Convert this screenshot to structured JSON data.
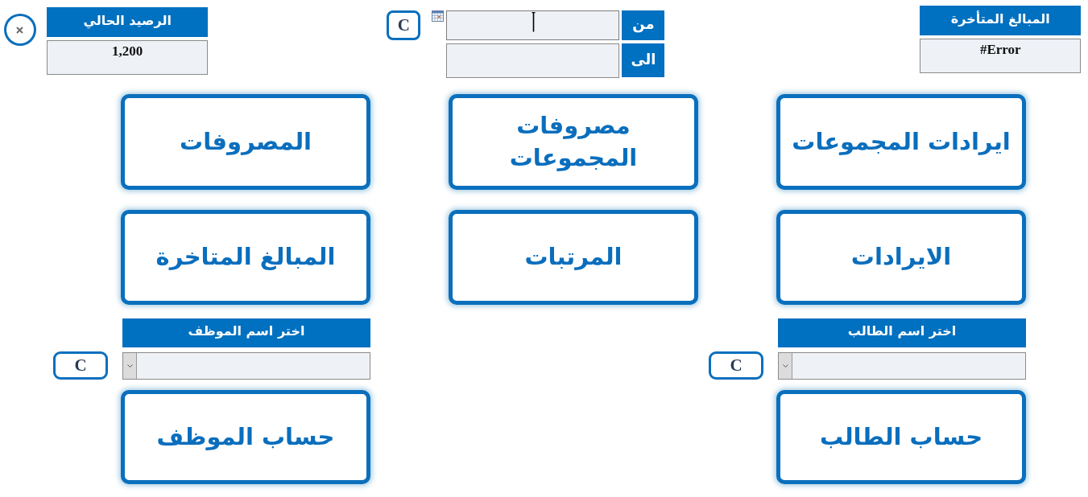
{
  "header": {
    "overdue": {
      "label": "المبالغ المتأخرة",
      "value": "#Error"
    },
    "date_range": {
      "clear_button": "C",
      "from": {
        "label": "من",
        "focused": true
      },
      "to": {
        "label": "الى",
        "focused": false
      }
    },
    "balance": {
      "label": "الرصيد الحالي",
      "value": "1,200"
    }
  },
  "nav_buttons": [
    "ايرادات المجموعات",
    "مصروفات المجموعات",
    "المصروفات",
    "الايرادات",
    "المرتبات",
    "المبالغ المتاخرة"
  ],
  "account_pickers": [
    {
      "label": "اختر اسم الطالب",
      "clear_button": "C",
      "account_button": "حساب الطالب"
    },
    {
      "label": "اختر اسم الموظف",
      "clear_button": "C",
      "account_button": "حساب الموظف"
    }
  ]
}
